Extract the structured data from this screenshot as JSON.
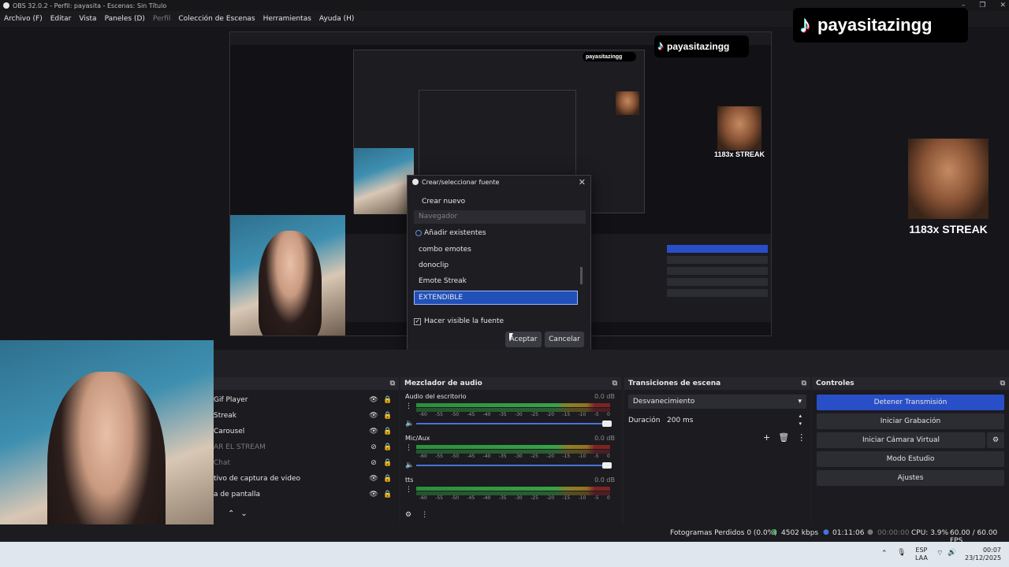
{
  "window": {
    "title": "OBS 32.0.2 - Perfil: payasita - Escenas: Sin Título",
    "controls": [
      "–",
      "❐",
      "✕"
    ]
  },
  "menu": [
    "Archivo (F)",
    "Editar",
    "Vista",
    "Paneles (D)",
    "Perfil",
    "Colección de Escenas",
    "Herramientas",
    "Ayuda (H)"
  ],
  "overlay": {
    "tiktok_handle": "payasitazingg",
    "streak": "1183x STREAK"
  },
  "dialog": {
    "title": "Crear/seleccionar fuente",
    "create_new": "Crear nuevo",
    "name_placeholder": "Navegador",
    "add_existing": "Añadir existentes",
    "sources": [
      "combo emotes",
      "donoclip",
      "Emote Streak",
      "EXTENDIBLE"
    ],
    "selected_source": "EXTENDIBLE",
    "make_visible": "Hacer visible la fuente",
    "accept": "Aceptar",
    "cancel": "Cancelar"
  },
  "sources_dock": {
    "items": [
      {
        "name": "Gif Player",
        "visible": true
      },
      {
        "name": "Streak",
        "visible": true
      },
      {
        "name": "Carousel",
        "visible": true
      },
      {
        "name": "AR EL STREAM",
        "visible": false
      },
      {
        "name": "Chat",
        "visible": false
      },
      {
        "name": "tivo de captura de video",
        "visible": true
      },
      {
        "name": "a de pantalla",
        "visible": true
      }
    ]
  },
  "mixer": {
    "title": "Mezclador de audio",
    "channels": [
      {
        "name": "Audio del escritorio",
        "db": "0.0 dB"
      },
      {
        "name": "Mic/Aux",
        "db": "0.0 dB"
      },
      {
        "name": "tts",
        "db": "0.0 dB"
      }
    ],
    "scale": [
      "-60",
      "-55",
      "-50",
      "-45",
      "-40",
      "-35",
      "-30",
      "-25",
      "-20",
      "-15",
      "-10",
      "-5",
      "0"
    ]
  },
  "transitions": {
    "title": "Transiciones de escena",
    "selected": "Desvanecimiento",
    "duration_label": "Duración",
    "duration_value": "200 ms"
  },
  "controls": {
    "title": "Controles",
    "stop_stream": "Detener Transmisión",
    "start_recording": "Iniciar Grabación",
    "start_virtual_cam": "Iniciar Cámara Virtual",
    "studio_mode": "Modo Estudio",
    "settings": "Ajustes"
  },
  "status": {
    "dropped_frames": "Fotogramas Perdidos 0 (0.0%)",
    "bitrate": "4502 kbps",
    "stream_time": "01:11:06",
    "rec_time": "00:00:00",
    "cpu": "CPU: 3.9%",
    "fps": "60.00 / 60.00 FPS"
  },
  "taskbar": {
    "lang": "ESP",
    "region": "LAA",
    "time": "00:07",
    "date": "23/12/2025"
  },
  "colors": {
    "accent": "#284fc7",
    "selection": "#2150b8",
    "panel_bg": "#1b1b20"
  }
}
